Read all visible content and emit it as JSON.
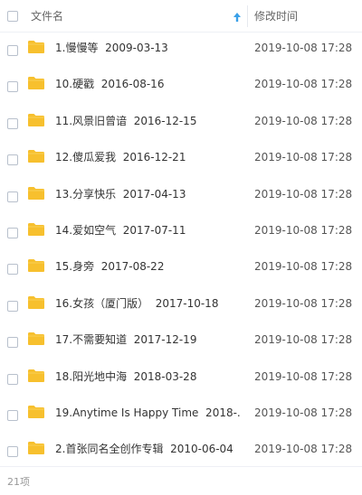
{
  "header": {
    "name_label": "文件名",
    "date_label": "修改时间",
    "sort_icon": "arrow-up-icon"
  },
  "rows": [
    {
      "name": "1.慢慢等  2009-03-13",
      "date": "2019-10-08 17:28"
    },
    {
      "name": "10.硬戳  2016-08-16",
      "date": "2019-10-08 17:28"
    },
    {
      "name": "11.风景旧曾谙  2016-12-15",
      "date": "2019-10-08 17:28"
    },
    {
      "name": "12.傻瓜爱我  2016-12-21",
      "date": "2019-10-08 17:28"
    },
    {
      "name": "13.分享快乐  2017-04-13",
      "date": "2019-10-08 17:28"
    },
    {
      "name": "14.爱如空气  2017-07-11",
      "date": "2019-10-08 17:28"
    },
    {
      "name": "15.身旁  2017-08-22",
      "date": "2019-10-08 17:28"
    },
    {
      "name": "16.女孩（厦门版）  2017-10-18",
      "date": "2019-10-08 17:28"
    },
    {
      "name": "17.不需要知道  2017-12-19",
      "date": "2019-10-08 17:28"
    },
    {
      "name": "18.阳光地中海  2018-03-28",
      "date": "2019-10-08 17:28"
    },
    {
      "name": "19.Anytime Is Happy Time  2018-...",
      "date": "2019-10-08 17:28"
    },
    {
      "name": "2.首张同名全创作专辑  2010-06-04",
      "date": "2019-10-08 17:28"
    }
  ],
  "footer": {
    "count": "21项"
  },
  "colors": {
    "folder": "#f7c02e",
    "sort_arrow": "#3aa0e8"
  }
}
